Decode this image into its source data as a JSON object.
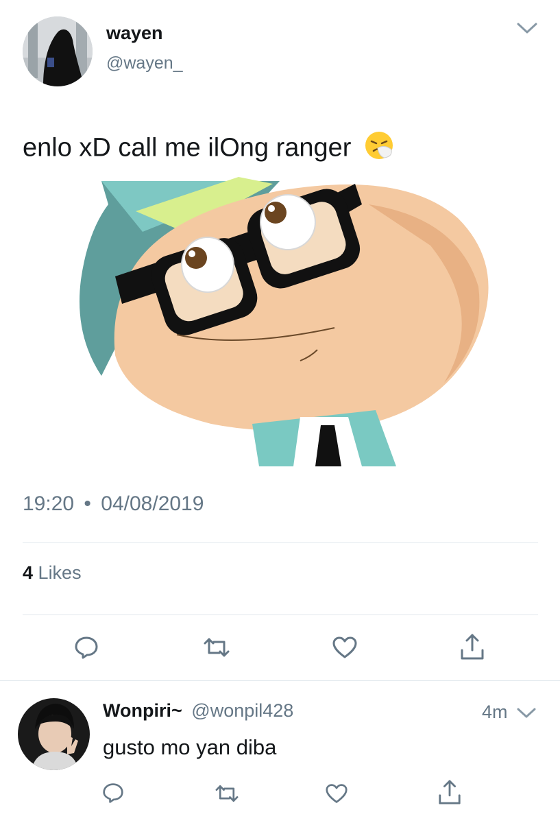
{
  "tweet": {
    "author_name": "wayen",
    "author_handle": "@wayen_",
    "text": "enlo xD call me ilOng ranger",
    "text_emoji": "sneezing-face-emoji",
    "time": "19:20",
    "separator": "•",
    "date": "04/08/2019",
    "likes_count": "4",
    "likes_label": "Likes",
    "image": "cartoon-character-with-glasses-and-teal-hat",
    "menu_icon": "chevron-down-icon"
  },
  "actions": [
    "reply-icon",
    "retweet-icon",
    "like-icon",
    "share-icon"
  ],
  "reply": {
    "author_name": "Wonpiri~",
    "author_handle": "@wonpil428",
    "time_ago": "4m",
    "text": "gusto mo yan diba",
    "menu_icon": "chevron-down-icon"
  },
  "colors": {
    "text": "#14171a",
    "muted": "#657786",
    "icon": "#657786",
    "divider": "#e1e8ed"
  }
}
